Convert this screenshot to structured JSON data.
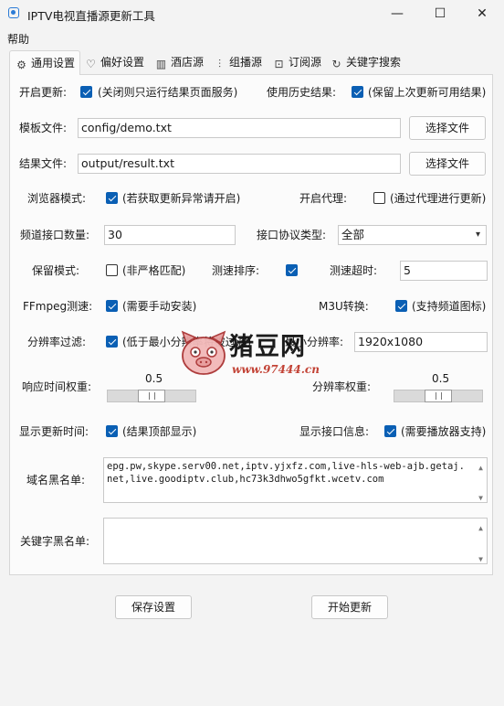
{
  "window": {
    "title": "IPTV电视直播源更新工具",
    "controls": {
      "minimize": "—",
      "maximize": "☐",
      "close": "✕"
    }
  },
  "menu": {
    "help": "帮助"
  },
  "tabs": [
    {
      "label": "通用设置",
      "icon": "gear-icon",
      "glyph": "⚙"
    },
    {
      "label": "偏好设置",
      "icon": "heart-icon",
      "glyph": "♡"
    },
    {
      "label": "酒店源",
      "icon": "hotel-icon",
      "glyph": "▥"
    },
    {
      "label": "组播源",
      "icon": "multicast-icon",
      "glyph": "⫶"
    },
    {
      "label": "订阅源",
      "icon": "bookmark-icon",
      "glyph": "⊡"
    },
    {
      "label": "关键字搜索",
      "icon": "search-refresh-icon",
      "glyph": "↻"
    }
  ],
  "general": {
    "open_update": {
      "label": "开启更新:",
      "checked": true,
      "desc": "(关闭则只运行结果页面服务)"
    },
    "use_history": {
      "label": "使用历史结果:",
      "checked": true,
      "desc": "(保留上次更新可用结果)"
    },
    "template_file": {
      "label": "模板文件:",
      "value": "config/demo.txt",
      "button": "选择文件"
    },
    "result_file": {
      "label": "结果文件:",
      "value": "output/result.txt",
      "button": "选择文件"
    },
    "browser_mode": {
      "label": "浏览器模式:",
      "checked": true,
      "desc": "(若获取更新异常请开启)"
    },
    "open_proxy": {
      "label": "开启代理:",
      "checked": false,
      "desc": "(通过代理进行更新)"
    },
    "channel_count": {
      "label": "频道接口数量:",
      "value": "30"
    },
    "protocol_type": {
      "label": "接口协议类型:",
      "value": "全部"
    },
    "keep_mode": {
      "label": "保留模式:",
      "checked": false,
      "desc": "(非严格匹配)"
    },
    "speed_sort": {
      "label": "测速排序:",
      "checked": true
    },
    "speed_timeout": {
      "label": "测速超时:",
      "value": "5"
    },
    "ffmpeg_test": {
      "label": "FFmpeg测速:",
      "checked": true,
      "desc": "(需要手动安装)"
    },
    "m3u_convert": {
      "label": "M3U转换:",
      "checked": true,
      "desc": "(支持频道图标)"
    },
    "resolution_filter": {
      "label": "分辨率过滤:",
      "checked": true,
      "desc": "(低于最小分辨率将被过滤)"
    },
    "min_resolution": {
      "label": "最小分辨率:",
      "value": "1920x1080"
    },
    "response_weight": {
      "label": "响应时间权重:",
      "value": "0.5",
      "fraction": 0.5
    },
    "resolution_weight": {
      "label": "分辨率权重:",
      "value": "0.5",
      "fraction": 0.5
    },
    "show_update_time": {
      "label": "显示更新时间:",
      "checked": true,
      "desc": "(结果顶部显示)"
    },
    "show_interface_info": {
      "label": "显示接口信息:",
      "checked": true,
      "desc": "(需要播放器支持)"
    },
    "domain_blacklist": {
      "label": "域名黑名单:",
      "value": "epg.pw,skype.serv00.net,iptv.yjxfz.com,live-hls-web-ajb.getaj.net,live.goodiptv.club,hc73k3dhwo5gfkt.wcetv.com"
    },
    "keyword_blacklist": {
      "label": "关键字黑名单:",
      "value": ""
    }
  },
  "actions": {
    "save": "保存设置",
    "start": "开始更新"
  },
  "watermark": {
    "brand": "猪豆网",
    "url": "www.97444.cn"
  }
}
